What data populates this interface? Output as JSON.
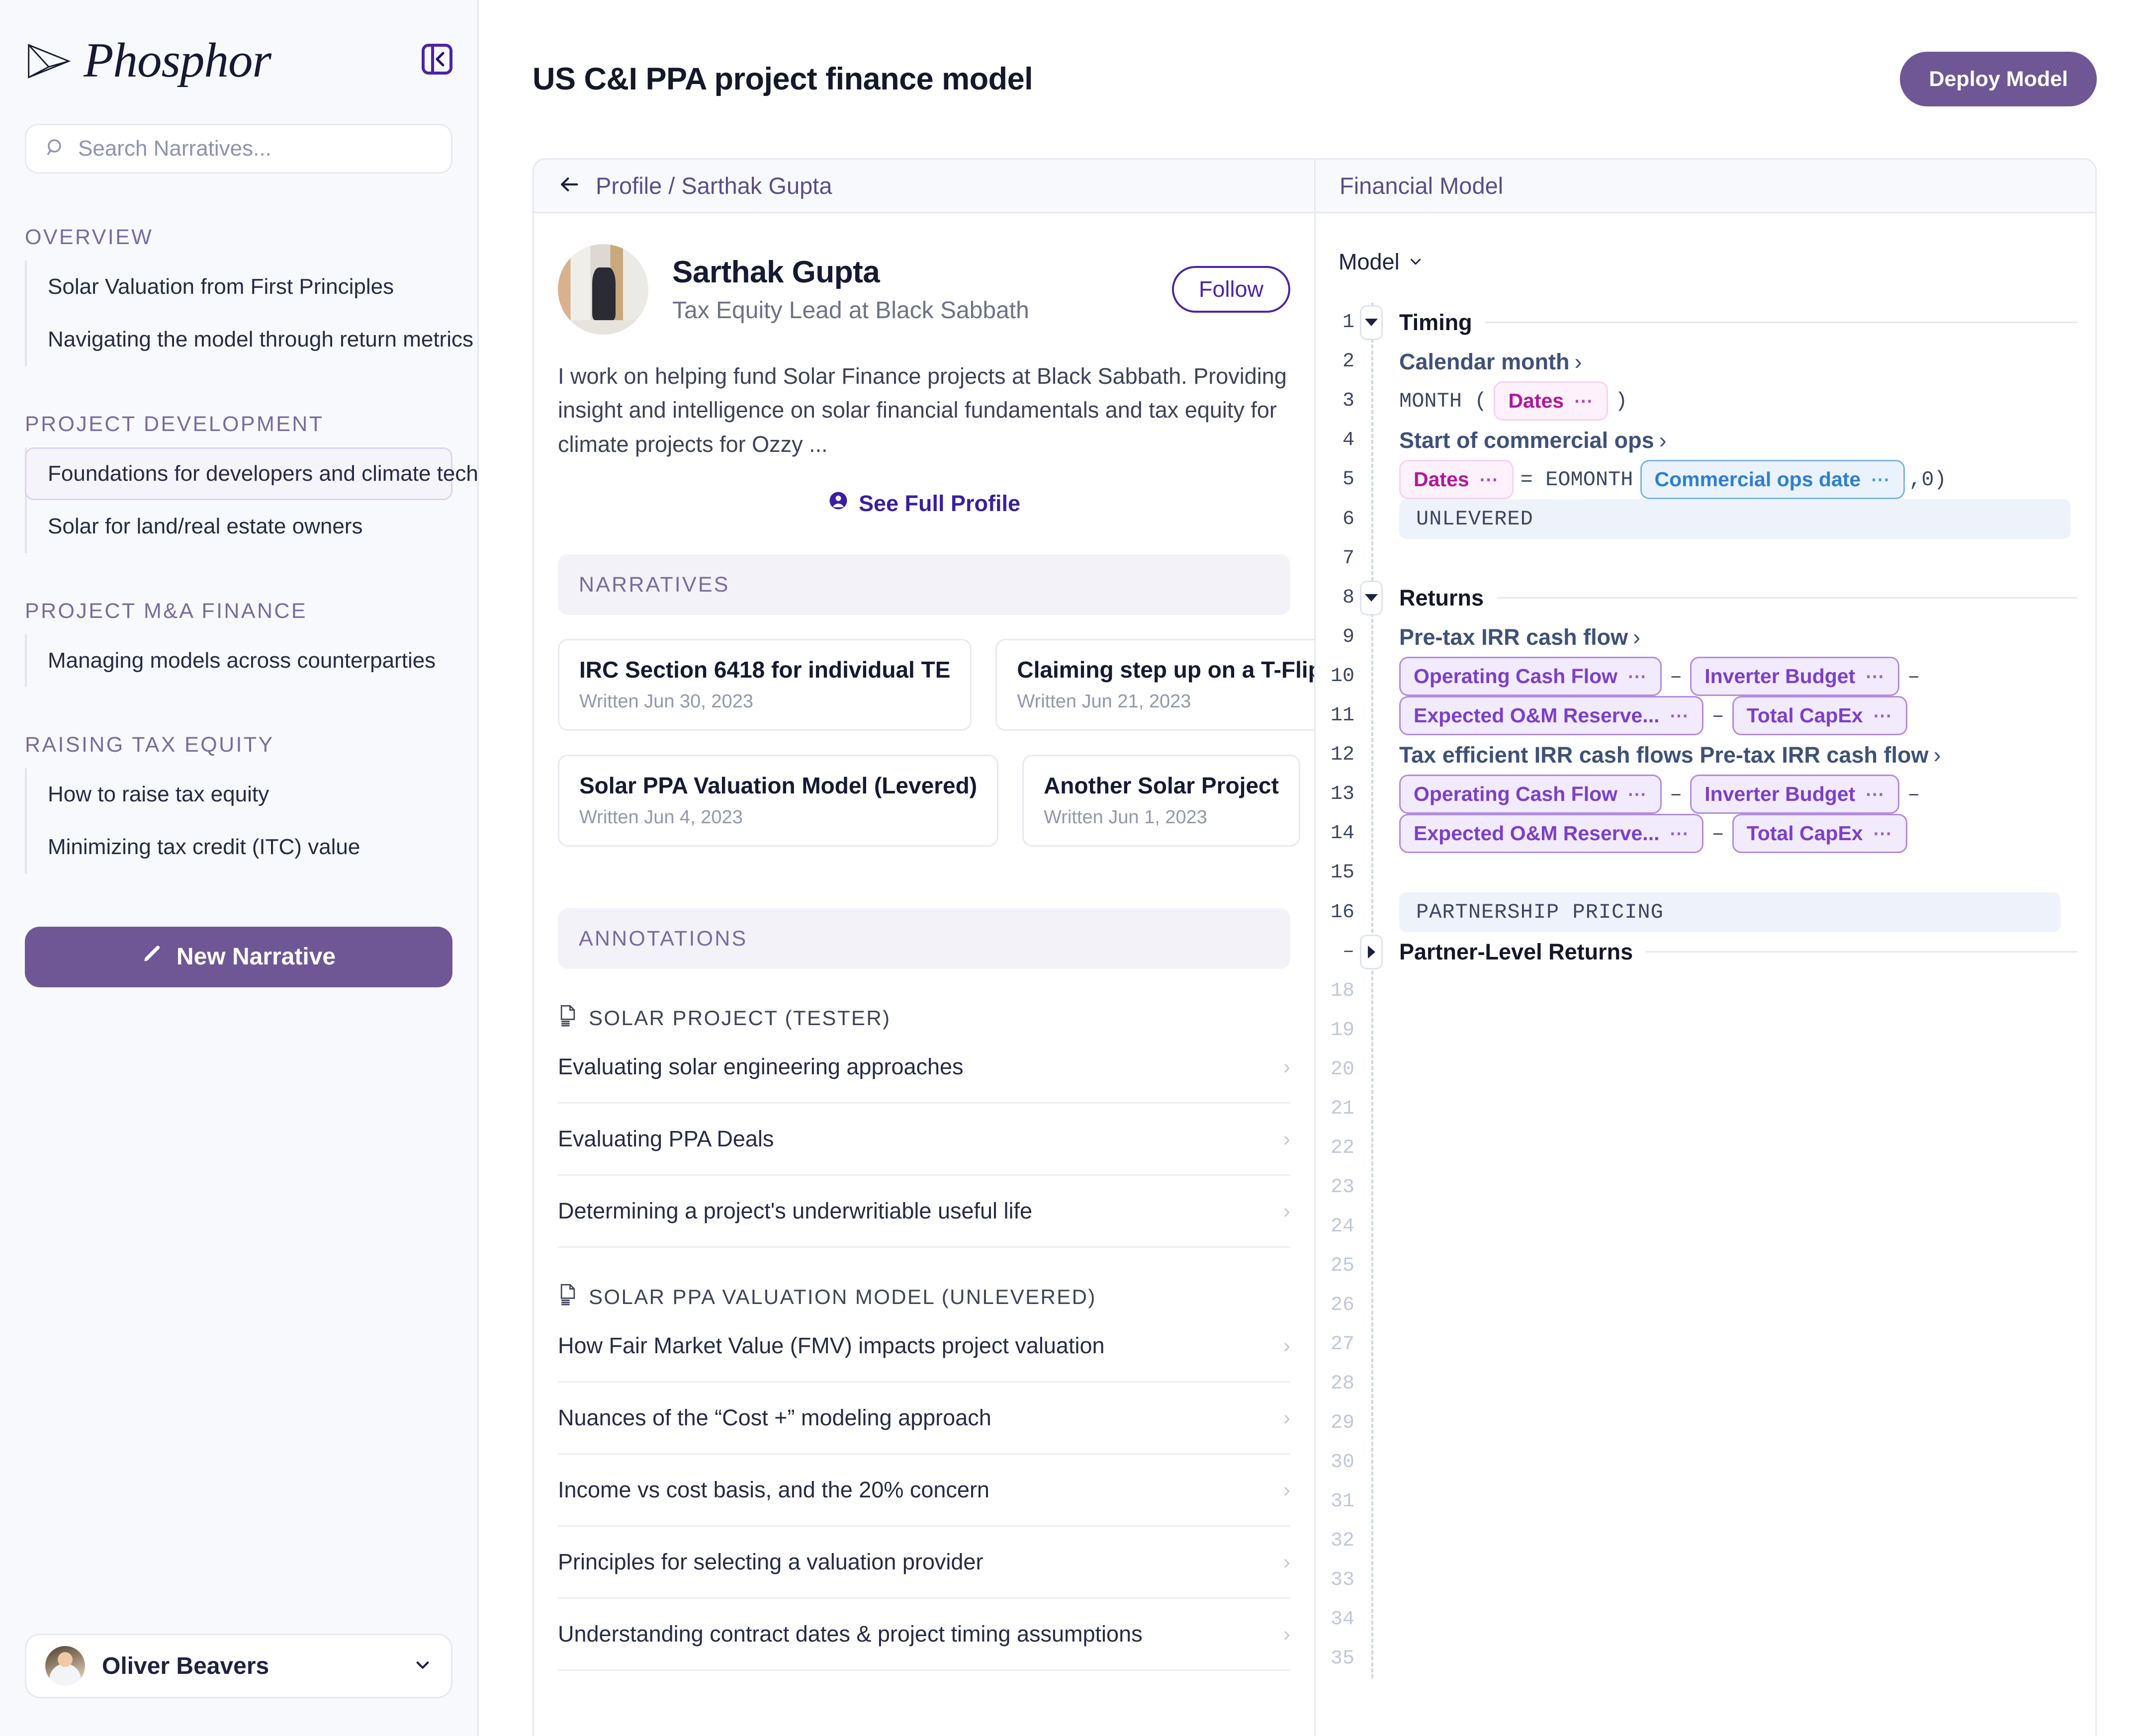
{
  "brand": {
    "name": "Phosphor",
    "logo_icon": "paper-plane-icon",
    "collapse_icon": "panel-collapse-left-icon"
  },
  "search": {
    "placeholder": "Search Narratives...",
    "value": "",
    "icon": "search-icon"
  },
  "sidebar": {
    "groups": [
      {
        "title": "OVERVIEW",
        "items": [
          {
            "label": "Solar Valuation from First Principles",
            "active": false
          },
          {
            "label": "Navigating the model through return metrics",
            "active": false
          }
        ]
      },
      {
        "title": "PROJECT DEVELOPMENT",
        "items": [
          {
            "label": "Foundations for developers and climate tech",
            "active": true
          },
          {
            "label": "Solar for land/real estate owners",
            "active": false
          }
        ]
      },
      {
        "title": "PROJECT M&A FINANCE",
        "items": [
          {
            "label": "Managing models across counterparties",
            "active": false
          }
        ]
      },
      {
        "title": "RAISING TAX EQUITY",
        "items": [
          {
            "label": "How to raise tax equity",
            "active": false
          },
          {
            "label": "Minimizing tax credit  (ITC) value",
            "active": false
          }
        ]
      }
    ],
    "new_narrative_label": "New Narrative",
    "new_narrative_icon": "pencil-icon",
    "user": {
      "name": "Oliver Beavers",
      "chevron_icon": "chevron-down-icon",
      "avatar_icon": "user-avatar"
    }
  },
  "header": {
    "title": "US C&I PPA project finance model",
    "deploy_label": "Deploy Model"
  },
  "profile_panel": {
    "back_icon": "arrow-left-icon",
    "breadcrumb": "Profile / Sarthak Gupta",
    "name": "Sarthak Gupta",
    "role": "Tax Equity Lead at Black Sabbath",
    "follow_label": "Follow",
    "bio": "I work on helping fund Solar Finance projects at Black Sabbath. Providing insight and intelligence on solar financial fundamentals and tax equity for climate projects for Ozzy ...",
    "see_full_profile": "See Full Profile",
    "see_full_profile_icon": "user-circle-icon",
    "narratives_band": "NARRATIVES",
    "narratives": [
      {
        "title": "IRC Section 6418 for individual TE",
        "date": "Written Jun 30, 2023"
      },
      {
        "title": "Claiming step up on a T-Flip",
        "date": "Written Jun 21, 2023"
      },
      {
        "title": "Solar PPA Valuation Model (Levered)",
        "date": "Written Jun 4, 2023"
      },
      {
        "title": "Another Solar Project",
        "date": "Written Jun 1, 2023"
      }
    ],
    "annotations_band": "ANNOTATIONS",
    "annotation_groups": [
      {
        "title": "SOLAR PROJECT (TESTER)",
        "icon": "document-icon",
        "items": [
          "Evaluating solar engineering approaches",
          "Evaluating PPA Deals",
          "Determining a project's underwritiable useful life"
        ]
      },
      {
        "title": "SOLAR PPA VALUATION MODEL (UNLEVERED)",
        "icon": "document-icon",
        "items": [
          "How Fair Market Value (FMV) impacts project valuation",
          "Nuances of the “Cost +” modeling approach",
          "Income vs cost basis, and the 20% concern",
          "Principles for selecting a valuation provider",
          "Understanding contract dates & project timing assumptions"
        ]
      }
    ]
  },
  "financial_model": {
    "panel_title": "Financial Model",
    "selector_label": "Model",
    "selector_icon": "chevron-down-icon",
    "rows": [
      {
        "n": "1",
        "kind": "group",
        "toggle": "down",
        "label": "Timing"
      },
      {
        "n": "2",
        "kind": "link",
        "label": "Calendar month"
      },
      {
        "n": "3",
        "kind": "formula_month",
        "fn": "MONTH (",
        "close": ")",
        "pill": "Dates"
      },
      {
        "n": "4",
        "kind": "link",
        "label": "Start of commercial ops"
      },
      {
        "n": "5",
        "kind": "formula_eomonth",
        "lhs": "Dates",
        "eq": "= EOMONTH",
        "arg": "Commercial ops date",
        "tail": ",0)"
      },
      {
        "n": "6",
        "kind": "band",
        "text": "UNLEVERED",
        "width": "w1"
      },
      {
        "n": "7",
        "kind": "blank"
      },
      {
        "n": "8",
        "kind": "group",
        "toggle": "down",
        "label": "Returns"
      },
      {
        "n": "9",
        "kind": "link",
        "label": "Pre-tax IRR cash flow"
      },
      {
        "n": "10",
        "kind": "pills2",
        "a": "Operating Cash Flow",
        "b": "Inverter Budget",
        "op": "–",
        "trail": "–"
      },
      {
        "n": "11",
        "kind": "pills2",
        "a": "Expected O&M Reserve...",
        "b": "Total CapEx",
        "op": "–",
        "trail": ""
      },
      {
        "n": "12",
        "kind": "link",
        "label": "Tax efficient IRR cash flows Pre-tax IRR cash flow"
      },
      {
        "n": "13",
        "kind": "pills2",
        "a": "Operating Cash Flow",
        "b": "Inverter Budget",
        "op": "–",
        "trail": "–"
      },
      {
        "n": "14",
        "kind": "pills2",
        "a": "Expected O&M Reserve...",
        "b": "Total CapEx",
        "op": "–",
        "trail": ""
      },
      {
        "n": "15",
        "kind": "blank"
      },
      {
        "n": "16",
        "kind": "band",
        "text": "PARTNERSHIP PRICING",
        "width": "w2"
      },
      {
        "n": "–",
        "kind": "group",
        "toggle": "right",
        "label": "Partner-Level Returns"
      },
      {
        "n": "18",
        "kind": "empty"
      },
      {
        "n": "19",
        "kind": "empty"
      },
      {
        "n": "20",
        "kind": "empty"
      },
      {
        "n": "21",
        "kind": "empty"
      },
      {
        "n": "22",
        "kind": "empty"
      },
      {
        "n": "23",
        "kind": "empty"
      },
      {
        "n": "24",
        "kind": "empty"
      },
      {
        "n": "25",
        "kind": "empty"
      },
      {
        "n": "26",
        "kind": "empty"
      },
      {
        "n": "27",
        "kind": "empty"
      },
      {
        "n": "28",
        "kind": "empty"
      },
      {
        "n": "29",
        "kind": "empty"
      },
      {
        "n": "30",
        "kind": "empty"
      },
      {
        "n": "31",
        "kind": "empty"
      },
      {
        "n": "32",
        "kind": "empty"
      },
      {
        "n": "33",
        "kind": "empty"
      },
      {
        "n": "34",
        "kind": "empty"
      },
      {
        "n": "35",
        "kind": "empty"
      }
    ]
  },
  "colors": {
    "brand_purple": "#6f5796",
    "accent_violet": "#4c24a8",
    "sidebar_bg": "#f8f9fc",
    "border": "#e6e9f2",
    "band_purple": "#f4f2f9",
    "band_blue": "#eef2fa",
    "pill_pink_text": "#b0179c",
    "pill_blue_text": "#2e7fd1",
    "pill_purple_text": "#7b40c9"
  }
}
